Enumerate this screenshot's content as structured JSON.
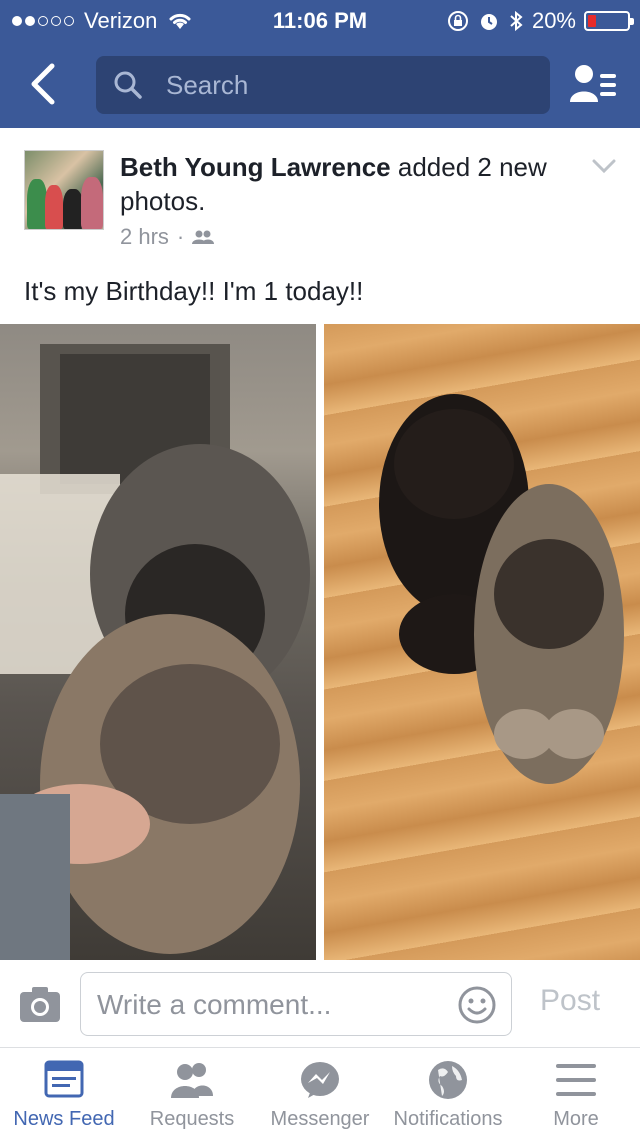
{
  "status_bar": {
    "carrier": "Verizon",
    "signal_bars_filled": 2,
    "signal_bars_total": 5,
    "time": "11:06 PM",
    "battery_percent": "20%",
    "battery_level": 0.2
  },
  "nav": {
    "search_placeholder": "Search"
  },
  "post": {
    "author": "Beth Young Lawrence",
    "action": " added 2 new photos.",
    "time": "2 hrs",
    "separator": "·",
    "audience_icon": "friends-icon",
    "caption": "It's my Birthday!! I'm 1 today!!",
    "photo_count": 2
  },
  "comment": {
    "placeholder": "Write a comment...",
    "post_label": "Post"
  },
  "tabs": [
    {
      "label": "News Feed",
      "icon": "news-feed-icon",
      "active": true
    },
    {
      "label": "Requests",
      "icon": "requests-icon",
      "active": false
    },
    {
      "label": "Messenger",
      "icon": "messenger-icon",
      "active": false
    },
    {
      "label": "Notifications",
      "icon": "globe-icon",
      "active": false
    },
    {
      "label": "More",
      "icon": "menu-icon",
      "active": false
    }
  ],
  "colors": {
    "brand": "#3b5998",
    "search_bg": "#2d4373",
    "active_tab": "#4267b2",
    "inactive": "#90949c",
    "battery_low": "#e62b2b"
  }
}
